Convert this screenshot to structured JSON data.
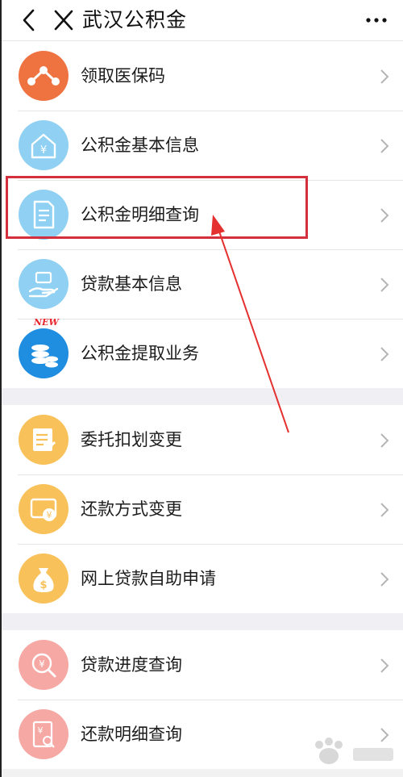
{
  "header": {
    "title": "武汉公积金"
  },
  "groups": [
    {
      "items": [
        {
          "label": "领取医保码",
          "icon": "share-nodes-icon",
          "color": "#ef7341"
        },
        {
          "label": "公积金基本信息",
          "icon": "house-yen-icon",
          "color": "#8fd0f3"
        },
        {
          "label": "公积金明细查询",
          "icon": "document-icon",
          "color": "#8fd0f3",
          "highlighted": true
        },
        {
          "label": "贷款基本信息",
          "icon": "hand-money-icon",
          "color": "#8fd0f3"
        },
        {
          "label": "公积金提取业务",
          "icon": "coin-stack-icon",
          "color": "#1f8de0",
          "badge": "NEW"
        }
      ]
    },
    {
      "items": [
        {
          "label": "委托扣划变更",
          "icon": "notepad-edit-icon",
          "color": "#f8c15a"
        },
        {
          "label": "还款方式变更",
          "icon": "card-yen-icon",
          "color": "#f8c15a"
        },
        {
          "label": "网上贷款自助申请",
          "icon": "money-bag-icon",
          "color": "#f8c15a"
        }
      ]
    },
    {
      "items": [
        {
          "label": "贷款进度查询",
          "icon": "search-yen-icon",
          "color": "#f6a9a4"
        },
        {
          "label": "还款明细查询",
          "icon": "doc-search-yen-icon",
          "color": "#f6a9a4"
        }
      ]
    }
  ]
}
